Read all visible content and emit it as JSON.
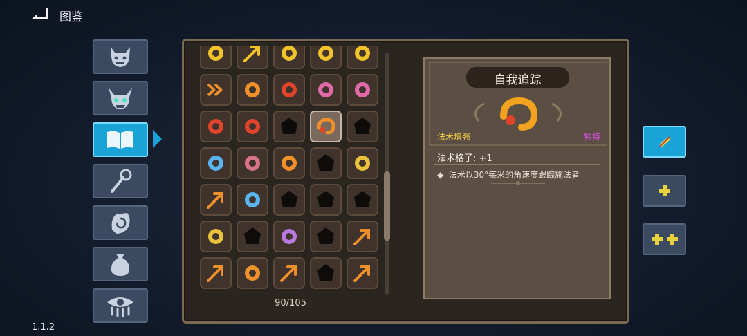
{
  "header": {
    "title": "图鉴",
    "back_icon": "back-arrow-icon"
  },
  "version": "1.1.2",
  "sidebar": {
    "tabs": [
      {
        "name": "monster-tab",
        "icon": "demon-face-icon",
        "active": false
      },
      {
        "name": "boss-tab",
        "icon": "horned-skull-icon",
        "active": false
      },
      {
        "name": "spellbook-tab",
        "icon": "open-book-icon",
        "active": true
      },
      {
        "name": "wand-tab",
        "icon": "wand-icon",
        "active": false
      },
      {
        "name": "relic-tab",
        "icon": "hand-spiral-icon",
        "active": false
      },
      {
        "name": "potion-tab",
        "icon": "sack-icon",
        "active": false
      },
      {
        "name": "curse-tab",
        "icon": "eye-icon",
        "active": false
      }
    ]
  },
  "collection": {
    "counter": "90/105",
    "rows": [
      [
        "yellow-shards",
        "yellow-arrows-up",
        "yellow-gear",
        "yellow-lightning-card",
        "yellow-cross-squares"
      ],
      [
        "orange-chevrons",
        "orange-sun",
        "red-bombs",
        "pink-cube",
        "pink-tentacle"
      ],
      [
        "red-burst",
        "red-swirl",
        "locked",
        "orange-hook-selected",
        "locked"
      ],
      [
        "blue-figure",
        "rose-flower",
        "orange-explosion",
        "locked",
        "gold-shield"
      ],
      [
        "orange-curve-arrow",
        "blue-ghost",
        "locked",
        "locked",
        "locked"
      ],
      [
        "gold-totem",
        "locked",
        "purple-clock",
        "locked",
        "orange-swirl-arrow"
      ],
      [
        "orange-arrow",
        "orange-asterisk",
        "orange-cross-arrows",
        "locked",
        "orange-sparkle-arrow"
      ]
    ],
    "selected": {
      "row": 2,
      "col": 3
    }
  },
  "detail": {
    "title": "自我追踪",
    "icon": "orange-hook-icon",
    "category": "法术增强",
    "rarity": "独特",
    "stat": "法术格子: +1",
    "description": "法术以30°每米的角速度跟踪施法者"
  },
  "side_buttons": [
    {
      "name": "slot-single-button",
      "icon": "strike-icon",
      "active": true
    },
    {
      "name": "slot-plus-button",
      "icon": "plus-icon",
      "active": false
    },
    {
      "name": "slot-double-plus-button",
      "icon": "double-plus-icon",
      "active": false
    }
  ],
  "colors": {
    "accent": "#1aa3d6",
    "category": "#f2d14a",
    "rarity_unique": "#e04cf0",
    "panel": "#5b4f43"
  }
}
